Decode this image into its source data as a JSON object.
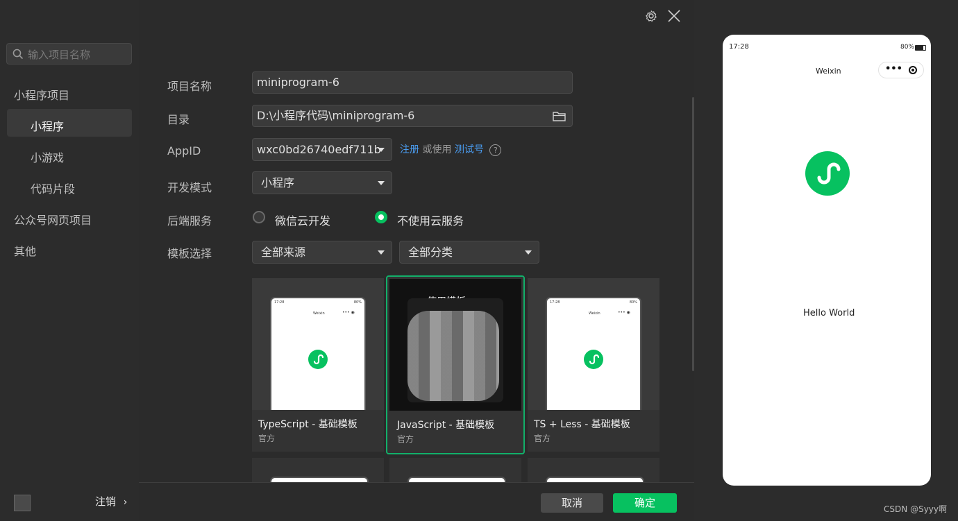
{
  "sidebar": {
    "search_placeholder": "输入项目名称",
    "section_miniprogram": "小程序项目",
    "items": [
      {
        "label": "小程序"
      },
      {
        "label": "小游戏"
      },
      {
        "label": "代码片段"
      }
    ],
    "section_official": "公众号网页项目",
    "section_other": "其他",
    "logout_label": "注销"
  },
  "form": {
    "name_label": "项目名称",
    "name_value": "miniprogram-6",
    "dir_label": "目录",
    "dir_value": "D:\\小程序代码\\miniprogram-6",
    "appid_label": "AppID",
    "appid_value": "wxc0bd26740edf711b",
    "register_link": "注册",
    "or_use_text": "或使用",
    "test_link": "测试号",
    "help_mark": "?",
    "mode_label": "开发模式",
    "mode_value": "小程序",
    "backend_label": "后端服务",
    "backend_options": [
      {
        "label": "微信云开发",
        "checked": false
      },
      {
        "label": "不使用云服务",
        "checked": true
      }
    ],
    "template_label": "模板选择",
    "source_value": "全部来源",
    "category_value": "全部分类"
  },
  "templates": [
    {
      "title": "TypeScript - 基础模板",
      "source": "官方",
      "selected": false
    },
    {
      "title": "JavaScript - 基础模板",
      "source": "官方",
      "selected": true,
      "overlay_text": "使用模板"
    },
    {
      "title": "TS + Less - 基础模板",
      "source": "官方",
      "selected": false
    }
  ],
  "thumb_phone": {
    "time": "17:28",
    "battery": "80%",
    "title": "Weixin"
  },
  "footer": {
    "cancel_label": "取消",
    "confirm_label": "确定"
  },
  "preview": {
    "time": "17:28",
    "battery": "80%",
    "nav_title": "Weixin",
    "hello_text": "Hello World"
  },
  "watermark": "CSDN @Syyy啊",
  "colors": {
    "accent_green": "#07c160",
    "link_blue": "#4a9cf0",
    "confirm_button": "#07c160"
  }
}
